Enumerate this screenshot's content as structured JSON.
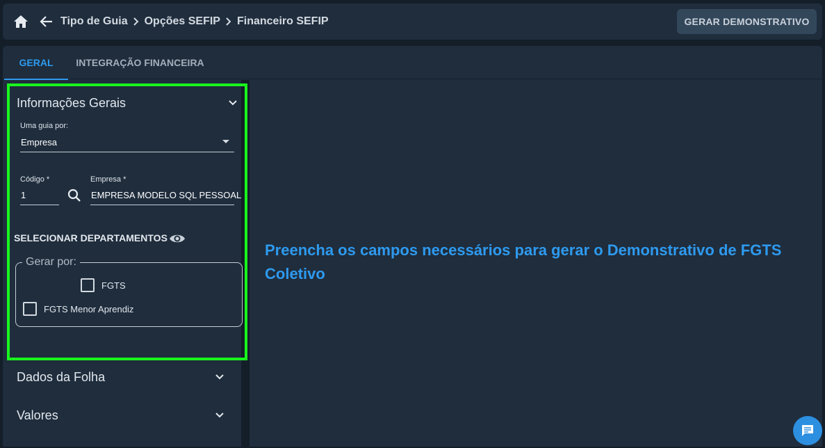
{
  "header": {
    "breadcrumb": [
      "Tipo de Guia",
      "Opções SEFIP",
      "Financeiro SEFIP"
    ],
    "action_label": "GERAR DEMONSTRATIVO",
    "icons": {
      "home": "home-icon",
      "back": "arrow-left-icon"
    }
  },
  "tabs": [
    {
      "label": "GERAL",
      "active": true
    },
    {
      "label": "INTEGRAÇÃO FINANCEIRA",
      "active": false
    }
  ],
  "informacoes_gerais": {
    "title": "Informações Gerais",
    "guia_por": {
      "label": "Uma guia por:",
      "value": "Empresa"
    },
    "codigo": {
      "label": "Código *",
      "value": "1"
    },
    "empresa": {
      "label": "Empresa *",
      "value": "EMPRESA MODELO SQL PESSOAL"
    },
    "departamentos_label": "SELECIONAR DEPARTAMENTOS",
    "gerar_por": {
      "legend": "Gerar por:",
      "options": [
        {
          "label": "FGTS",
          "checked": false
        },
        {
          "label": "FGTS Menor Aprendiz",
          "checked": false
        }
      ]
    }
  },
  "sections": [
    {
      "title": "Dados da Folha"
    },
    {
      "title": "Valores"
    }
  ],
  "message": "Preencha os campos necessários para gerar o Demonstrativo de FGTS Coletivo",
  "colors": {
    "accent": "#2e9aef",
    "highlight": "#18f51d",
    "panel": "#1f2d3d",
    "background": "#141e29"
  }
}
